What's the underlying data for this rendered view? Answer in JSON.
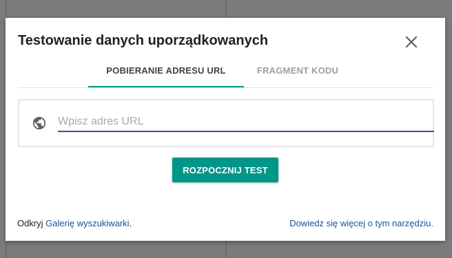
{
  "dialog": {
    "title": "Testowanie danych uporządkowanych",
    "close_icon": "close-icon"
  },
  "tabs": [
    {
      "label": "POBIERANIE ADRESU URL",
      "active": true
    },
    {
      "label": "FRAGMENT KODU",
      "active": false
    }
  ],
  "url_input": {
    "icon": "globe-icon",
    "value": "",
    "placeholder": "Wpisz adres URL"
  },
  "run_button": {
    "label": "ROZPOCZNIJ TEST"
  },
  "footer": {
    "left_prefix": "Odkryj ",
    "left_link": "Galerię wyszukiwarki",
    "left_suffix": ".",
    "right_link": "Dowiedz się więcej o tym narzędziu."
  },
  "colors": {
    "accent": "#009688",
    "link": "#1a4fa0",
    "input_underline": "#3f4f8c"
  }
}
